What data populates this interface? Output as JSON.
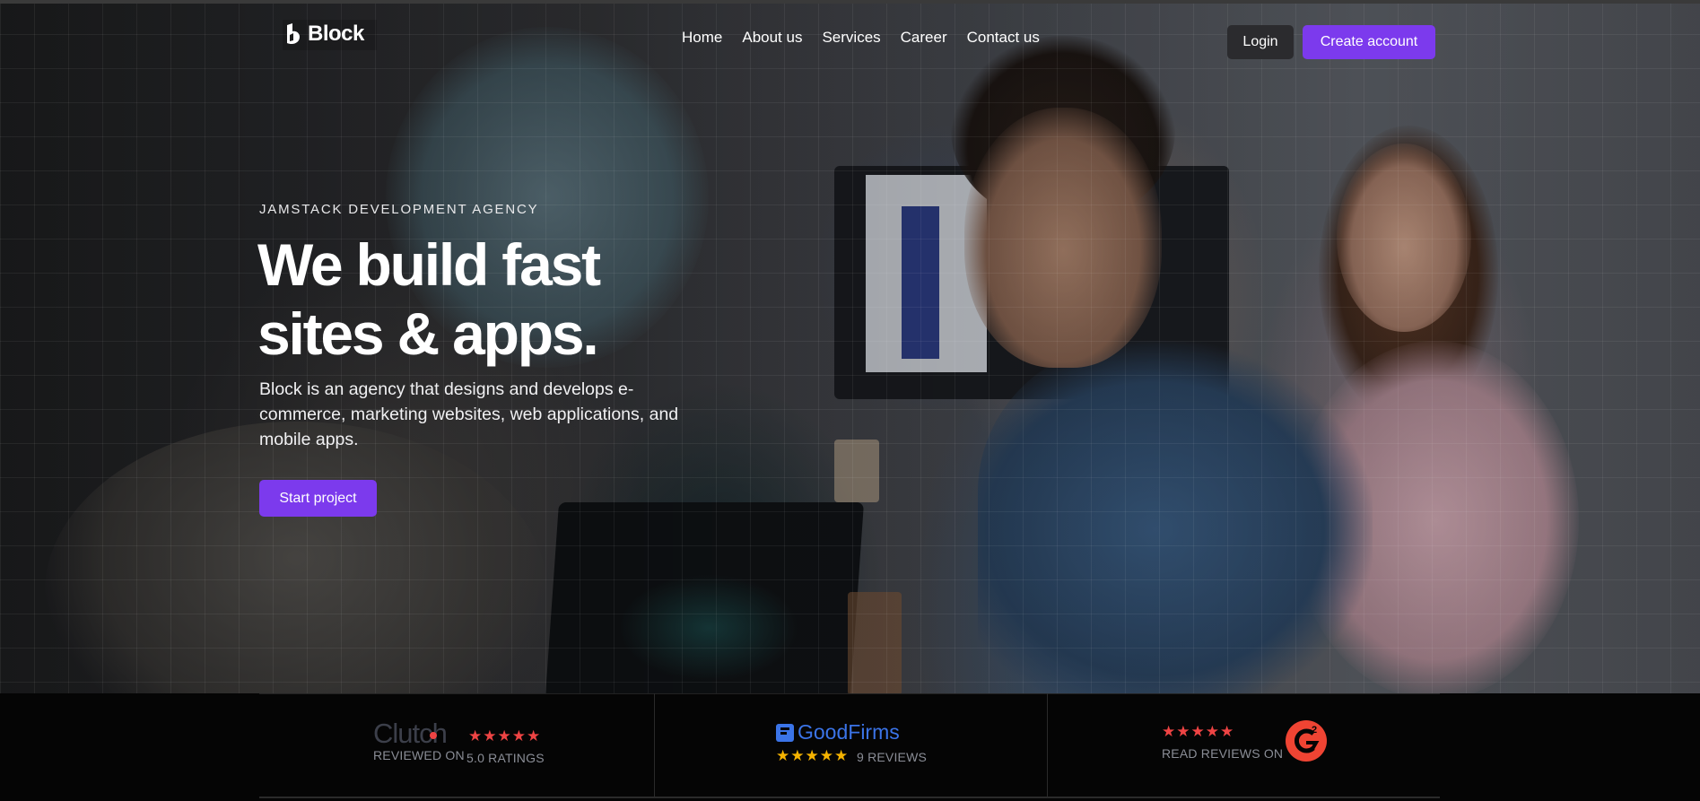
{
  "brand": {
    "name": "Block"
  },
  "nav": {
    "items": [
      {
        "label": "Home"
      },
      {
        "label": "About us"
      },
      {
        "label": "Services"
      },
      {
        "label": "Career"
      },
      {
        "label": "Contact us"
      }
    ]
  },
  "auth": {
    "login_label": "Login",
    "create_label": "Create account"
  },
  "hero": {
    "eyebrow": "JAMSTACK DEVELOPMENT AGENCY",
    "headline_line1": "We build fast",
    "headline_line2": "sites & apps.",
    "lede": "Block is an agency that designs and develops e-commerce, marketing websites, web applications, and mobile apps.",
    "cta_label": "Start project"
  },
  "reviews": {
    "clutch": {
      "logo_text": "Clutch",
      "sub": "REVIEWED ON",
      "stars": "★★★★★",
      "rating": "5.0 RATINGS",
      "star_color": "#ef4444"
    },
    "goodfirms": {
      "logo_text": "GoodFirms",
      "stars": "★★★★★",
      "count": "9 REVIEWS",
      "star_color": "#f5b301"
    },
    "g2": {
      "stars": "★★★★★",
      "sub": "READ REVIEWS ON",
      "logo_text": "G2",
      "star_color": "#ef4444"
    }
  },
  "colors": {
    "accent": "#7c3aed",
    "login_bg": "#2b2b2e",
    "goodfirms_blue": "#3b74e8",
    "g2_red": "#ef4433"
  }
}
